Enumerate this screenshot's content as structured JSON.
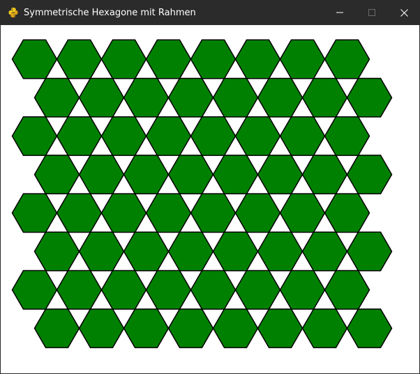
{
  "window": {
    "title": "Symmetrische Hexagone mit Rahmen",
    "app_icon": "python-snake-icon",
    "titlebar_color": "#2b2b2b",
    "controls": {
      "minimize": "minimize-icon",
      "maximize": "maximize-icon",
      "close": "close-icon"
    }
  },
  "canvas": {
    "background": "#ffffff",
    "hexagon_fill": "#008000",
    "hexagon_stroke": "#000000",
    "grid": {
      "rows": 8,
      "columns_per_row": 8
    }
  }
}
